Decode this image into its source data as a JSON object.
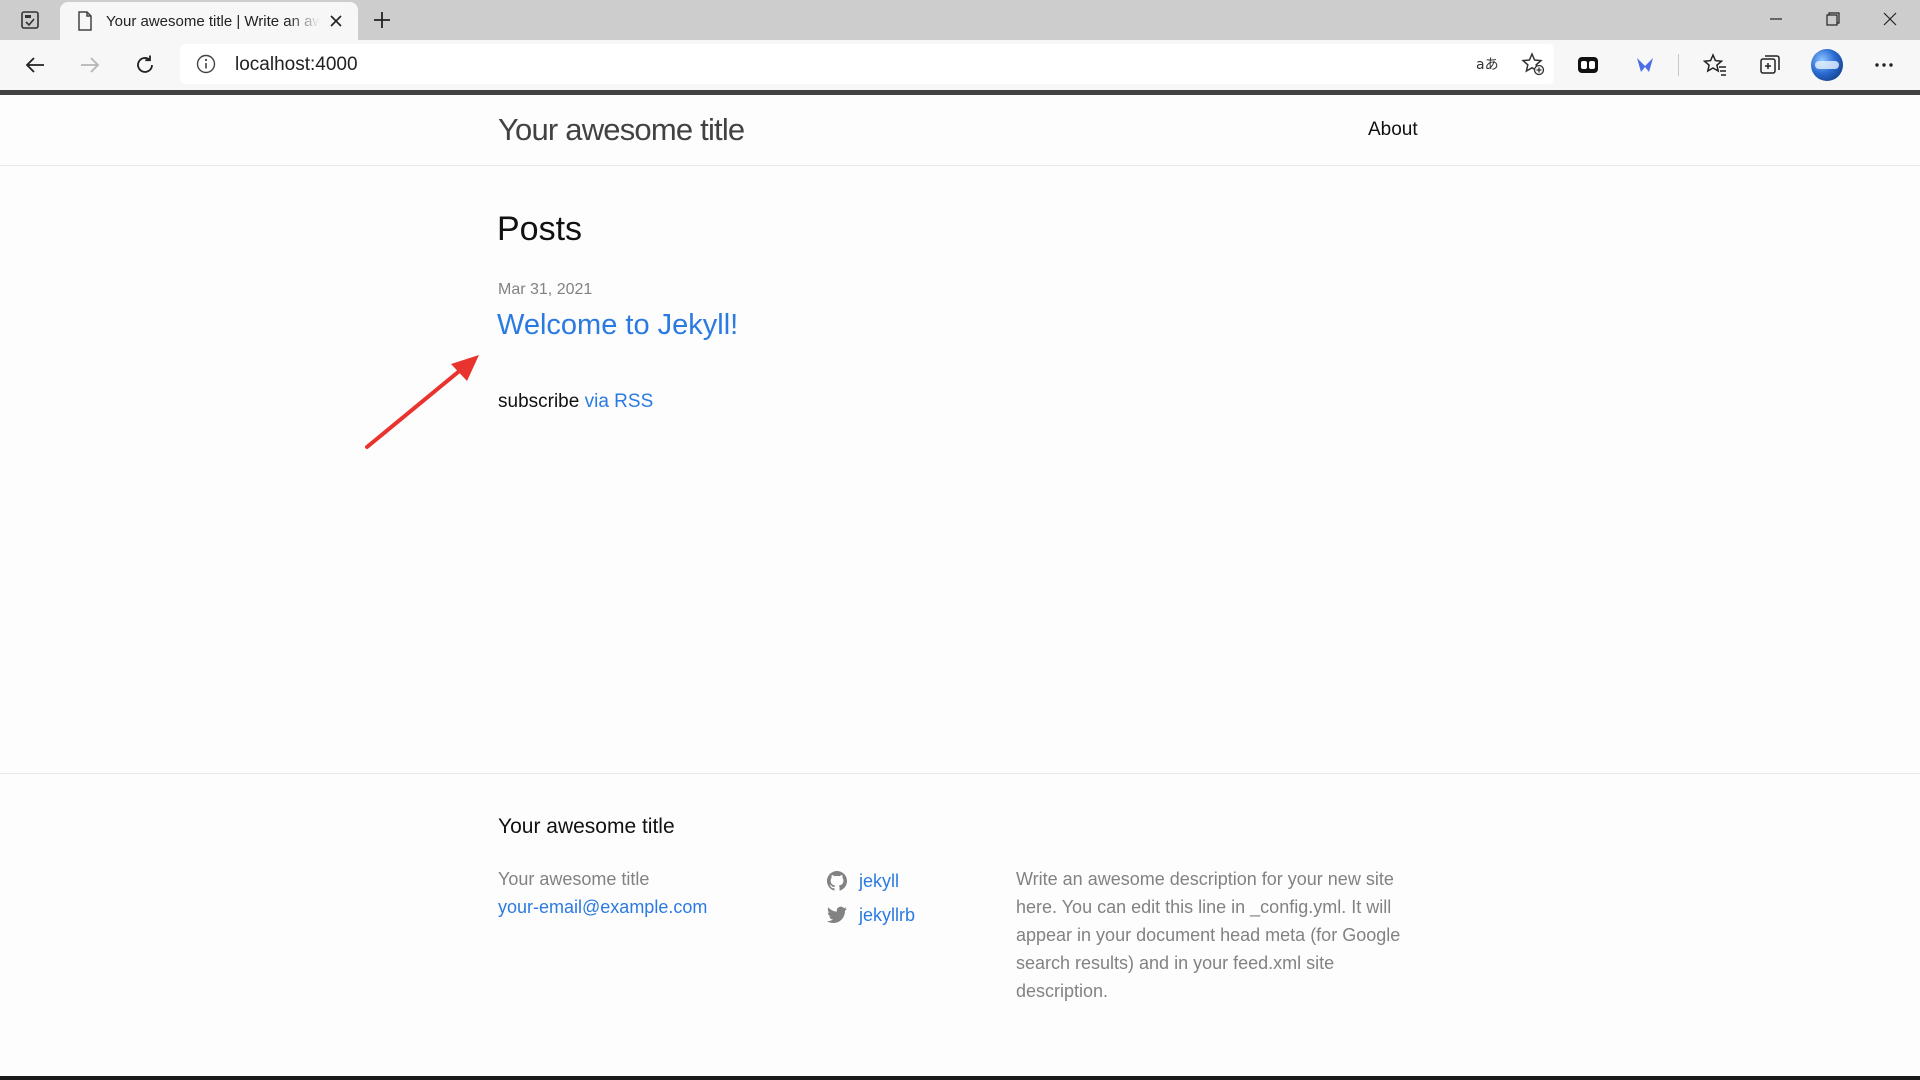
{
  "browser": {
    "tab_title": "Your awesome title | Write an awesome description for your new site here",
    "url": "localhost:4000"
  },
  "header": {
    "site_title": "Your awesome title",
    "nav_about": "About"
  },
  "main": {
    "heading": "Posts",
    "posts": [
      {
        "date": "Mar 31, 2021",
        "title": "Welcome to Jekyll!"
      }
    ],
    "rss_prefix": "subscribe",
    "rss_link": "via RSS"
  },
  "footer": {
    "heading": "Your awesome title",
    "site_name": "Your awesome title",
    "email": "your-email@example.com",
    "social": [
      {
        "icon": "github-icon",
        "label": "jekyll"
      },
      {
        "icon": "twitter-icon",
        "label": "jekyllrb"
      }
    ],
    "description": "Write an awesome description for your new site here. You can edit this line in _config.yml. It will appear in your document head meta (for Google search results) and in your feed.xml site description."
  },
  "colors": {
    "link": "#2a7ae2",
    "annotation_arrow": "#e8332f"
  }
}
